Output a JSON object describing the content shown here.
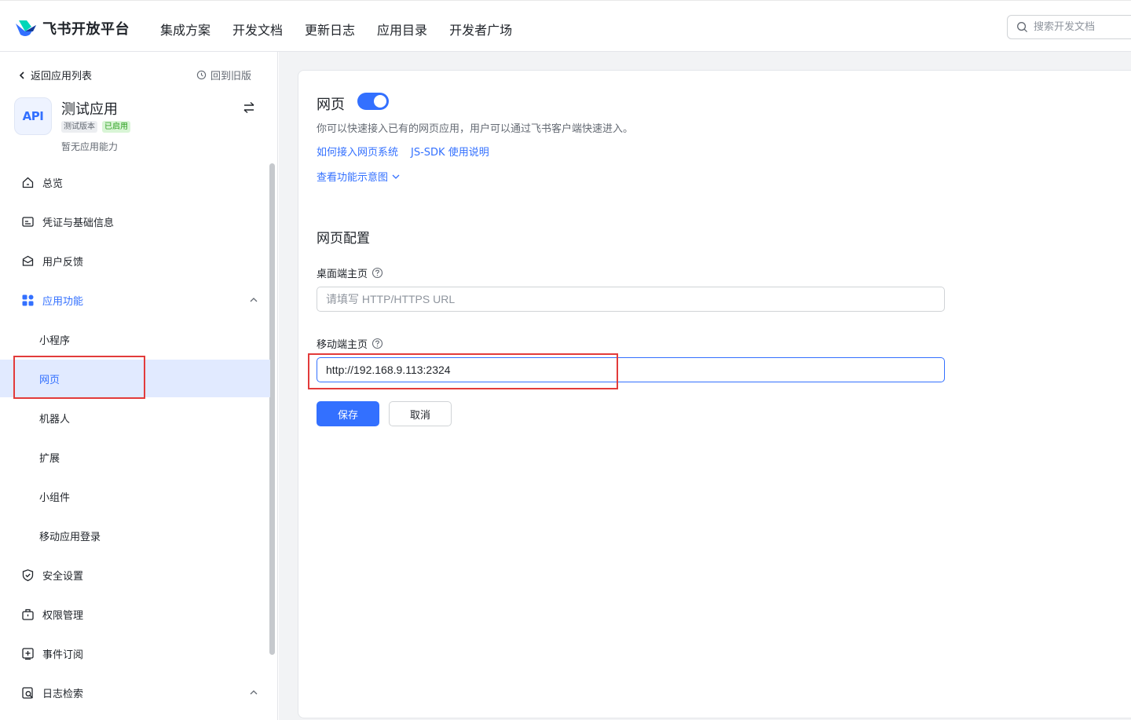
{
  "header": {
    "logo_text": "飞书开放平台",
    "nav": [
      "集成方案",
      "开发文档",
      "更新日志",
      "应用目录",
      "开发者广场"
    ],
    "search_placeholder": "搜索开发文档"
  },
  "sidebar": {
    "back_label": "返回应用列表",
    "old_version_label": "回到旧版",
    "app": {
      "avatar_text": "API",
      "name": "测试应用",
      "badge_version": "测试版本",
      "badge_status": "已启用",
      "description": "暂无应用能力"
    },
    "menu": {
      "overview": "总览",
      "credentials": "凭证与基础信息",
      "feedback": "用户反馈",
      "features": "应用功能",
      "miniprogram": "小程序",
      "webpage": "网页",
      "bot": "机器人",
      "extension": "扩展",
      "widget": "小组件",
      "mobile_login": "移动应用登录",
      "security": "安全设置",
      "permissions": "权限管理",
      "events": "事件订阅",
      "logs": "日志检索"
    }
  },
  "main": {
    "title": "网页",
    "toggle_on": true,
    "description": "你可以快速接入已有的网页应用，用户可以通过飞书客户端快速进入。",
    "link_integrate": "如何接入网页系统",
    "link_jssdk": "JS-SDK 使用说明",
    "link_preview": "查看功能示意图",
    "section_title": "网页配置",
    "desktop_label": "桌面端主页",
    "desktop_placeholder": "请填写 HTTP/HTTPS URL",
    "desktop_value": "",
    "mobile_label": "移动端主页",
    "mobile_value": "http://192.168.9.113:2324",
    "save_label": "保存",
    "cancel_label": "取消"
  },
  "colors": {
    "accent": "#3370ff",
    "highlight_box": "#e23b3b",
    "selected_bg": "#e1eaff",
    "badge_green": "#2ea121"
  }
}
